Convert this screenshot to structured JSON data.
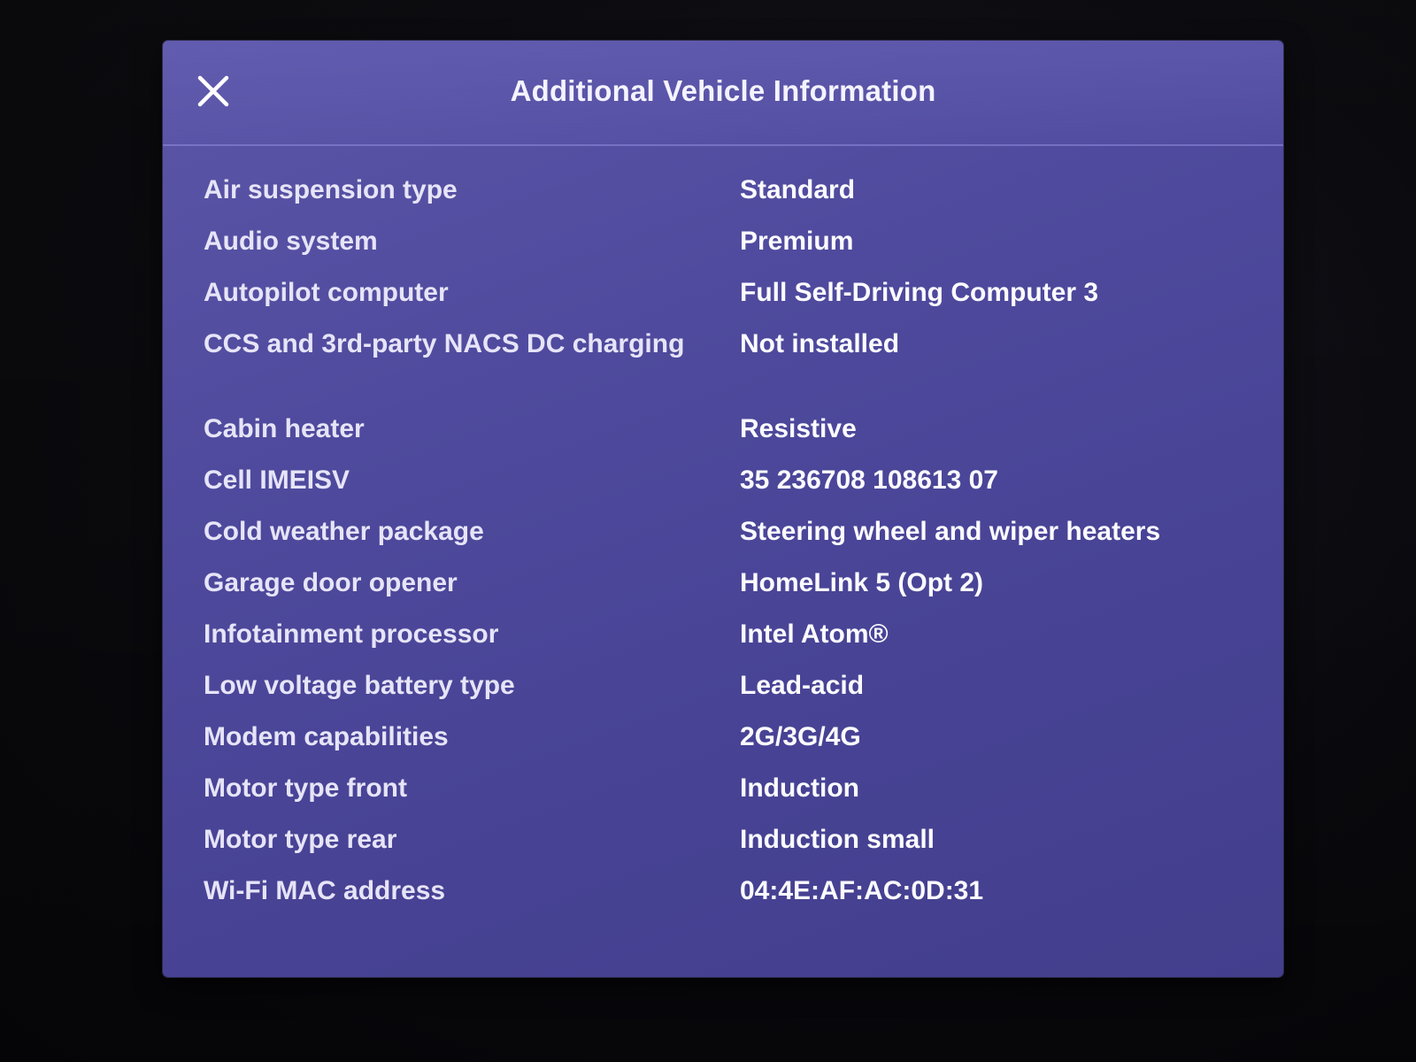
{
  "dialog": {
    "title": "Additional Vehicle Information",
    "close_icon": "close-icon"
  },
  "info": {
    "rows": [
      {
        "label": "Air suspension type",
        "value": "Standard"
      },
      {
        "label": "Audio system",
        "value": "Premium"
      },
      {
        "label": "Autopilot computer",
        "value": "Full Self-Driving Computer 3"
      },
      {
        "label": "CCS and 3rd-party NACS DC charging",
        "value": "Not installed"
      },
      {
        "label": "Cabin heater",
        "value": "Resistive"
      },
      {
        "label": "Cell IMEISV",
        "value": "35 236708 108613 07"
      },
      {
        "label": "Cold weather package",
        "value": "Steering wheel and wiper heaters"
      },
      {
        "label": "Garage door opener",
        "value": "HomeLink 5 (Opt 2)"
      },
      {
        "label": "Infotainment processor",
        "value": "Intel Atom®"
      },
      {
        "label": "Low voltage battery type",
        "value": "Lead-acid"
      },
      {
        "label": "Modem capabilities",
        "value": "2G/3G/4G"
      },
      {
        "label": "Motor type front",
        "value": "Induction"
      },
      {
        "label": "Motor type rear",
        "value": "Induction small"
      },
      {
        "label": "Wi-Fi MAC address",
        "value": "04:4E:AF:AC:0D:31"
      }
    ]
  },
  "colors": {
    "dialog_background": "#4f4a9d",
    "text": "#f4f3ff"
  }
}
